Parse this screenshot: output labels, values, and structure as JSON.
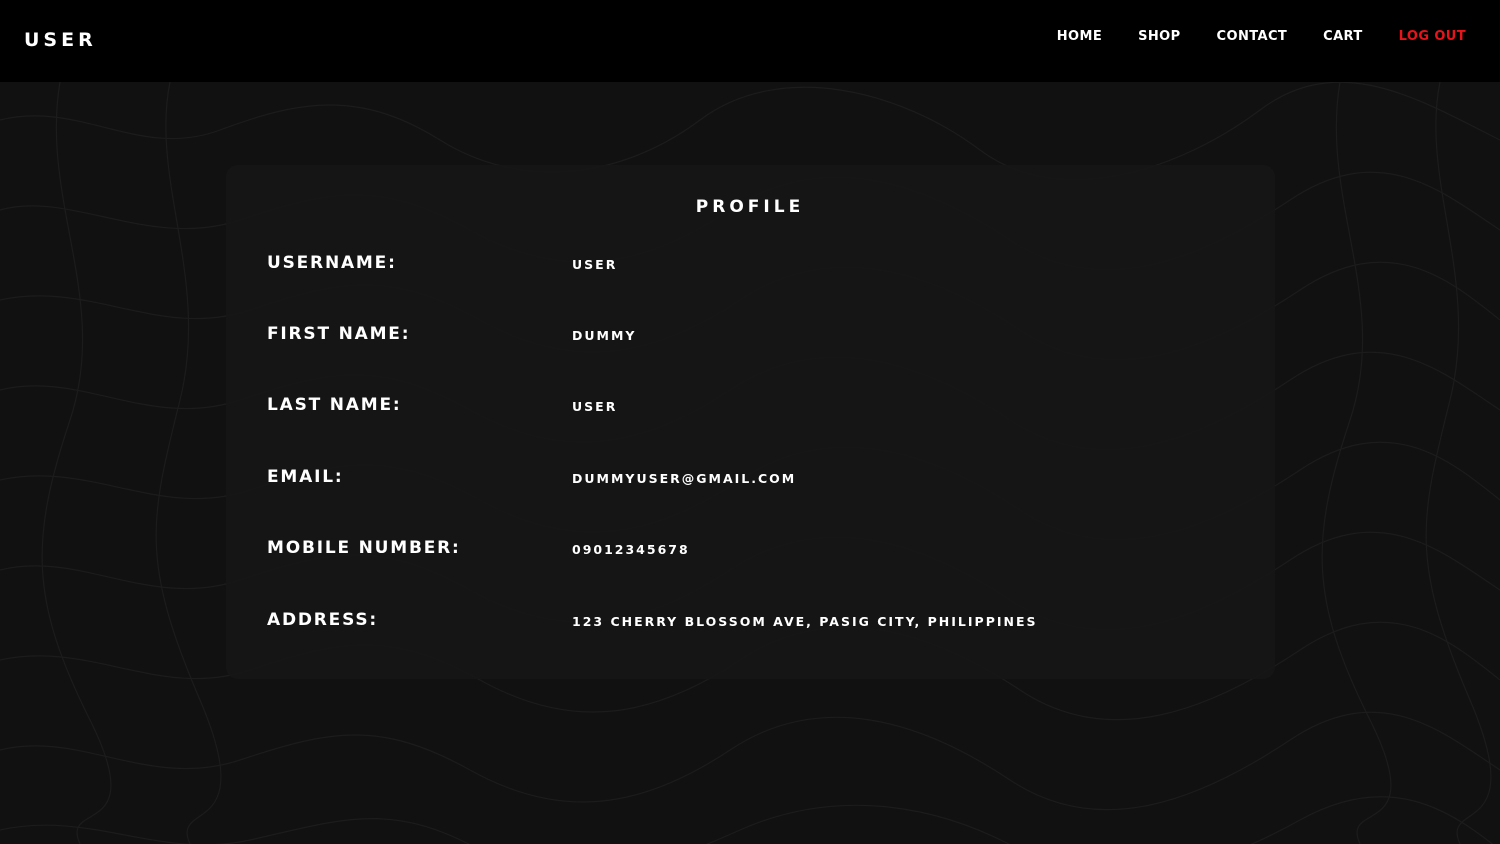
{
  "nav": {
    "brand": "USER",
    "links": [
      {
        "label": "HOME"
      },
      {
        "label": "SHOP"
      },
      {
        "label": "CONTACT"
      },
      {
        "label": "CART"
      },
      {
        "label": "LOG OUT"
      }
    ],
    "logout_color": "#e8141b"
  },
  "profile": {
    "title": "PROFILE",
    "fields": [
      {
        "label": "USERNAME:",
        "value": "USER"
      },
      {
        "label": "FIRST NAME:",
        "value": "DUMMY"
      },
      {
        "label": "LAST NAME:",
        "value": "USER"
      },
      {
        "label": "EMAIL:",
        "value": "DUMMYUSER@GMAIL.COM"
      },
      {
        "label": "MOBILE NUMBER:",
        "value": "09012345678"
      },
      {
        "label": "ADDRESS:",
        "value": "123 CHERRY BLOSSOM AVE, PASIG CITY, PHILIPPINES"
      }
    ]
  },
  "theme": {
    "background": "#111111",
    "navbar": "#000000",
    "card": "#161616",
    "text": "#ffffff"
  }
}
